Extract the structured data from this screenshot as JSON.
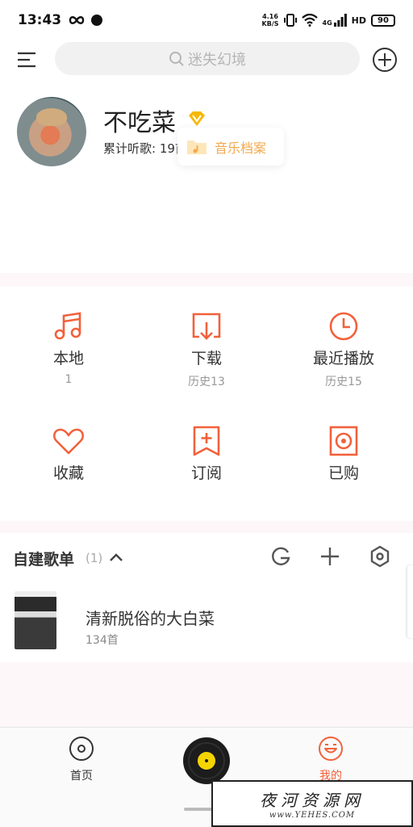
{
  "status_bar": {
    "time": "13:43",
    "net_speed_value": "4.16",
    "net_speed_unit": "KB/S",
    "signal_label": "4G",
    "hd_label": "HD",
    "battery": "90"
  },
  "search": {
    "placeholder": "迷失幻境"
  },
  "profile": {
    "username": "不吃菜",
    "listen_stats": "累计听歌: 19首",
    "archive_label": "音乐档案"
  },
  "grid": [
    {
      "label": "本地",
      "sub": "1"
    },
    {
      "label": "下载",
      "sub": "历史13"
    },
    {
      "label": "最近播放",
      "sub": "历史15"
    },
    {
      "label": "收藏",
      "sub": ""
    },
    {
      "label": "订阅",
      "sub": ""
    },
    {
      "label": "已购",
      "sub": ""
    }
  ],
  "playlists": {
    "title": "自建歌单",
    "count": "(1)",
    "items": [
      {
        "name": "清新脱俗的大白菜",
        "meta": "134首"
      }
    ]
  },
  "bottom_nav": {
    "home_label": "首页",
    "mine_label": "我的"
  },
  "watermark": {
    "title": "夜河资源网",
    "url": "www.YEHES.COM"
  },
  "colors": {
    "accent": "#f2613b",
    "orange": "#f3a94d",
    "gold": "#f5b800"
  }
}
